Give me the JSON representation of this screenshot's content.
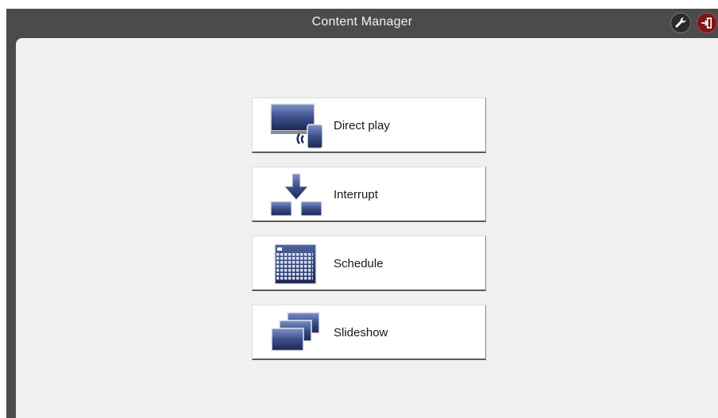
{
  "window": {
    "title": "Content Manager"
  },
  "header": {
    "settings_icon": "wrench-icon",
    "logout_icon": "logout-icon"
  },
  "menu": {
    "items": [
      {
        "label": "Direct play",
        "icon": "direct-play-icon"
      },
      {
        "label": "Interrupt",
        "icon": "interrupt-icon"
      },
      {
        "label": "Schedule",
        "icon": "calendar-icon"
      },
      {
        "label": "Slideshow",
        "icon": "slideshow-icon"
      }
    ]
  },
  "colors": {
    "frame": "#4b4b4b",
    "content_bg": "#f0f0f0",
    "logout_bg": "#7a1717",
    "icon_blue_dark": "#1f2d5a",
    "icon_blue_light": "#6f86c0"
  }
}
